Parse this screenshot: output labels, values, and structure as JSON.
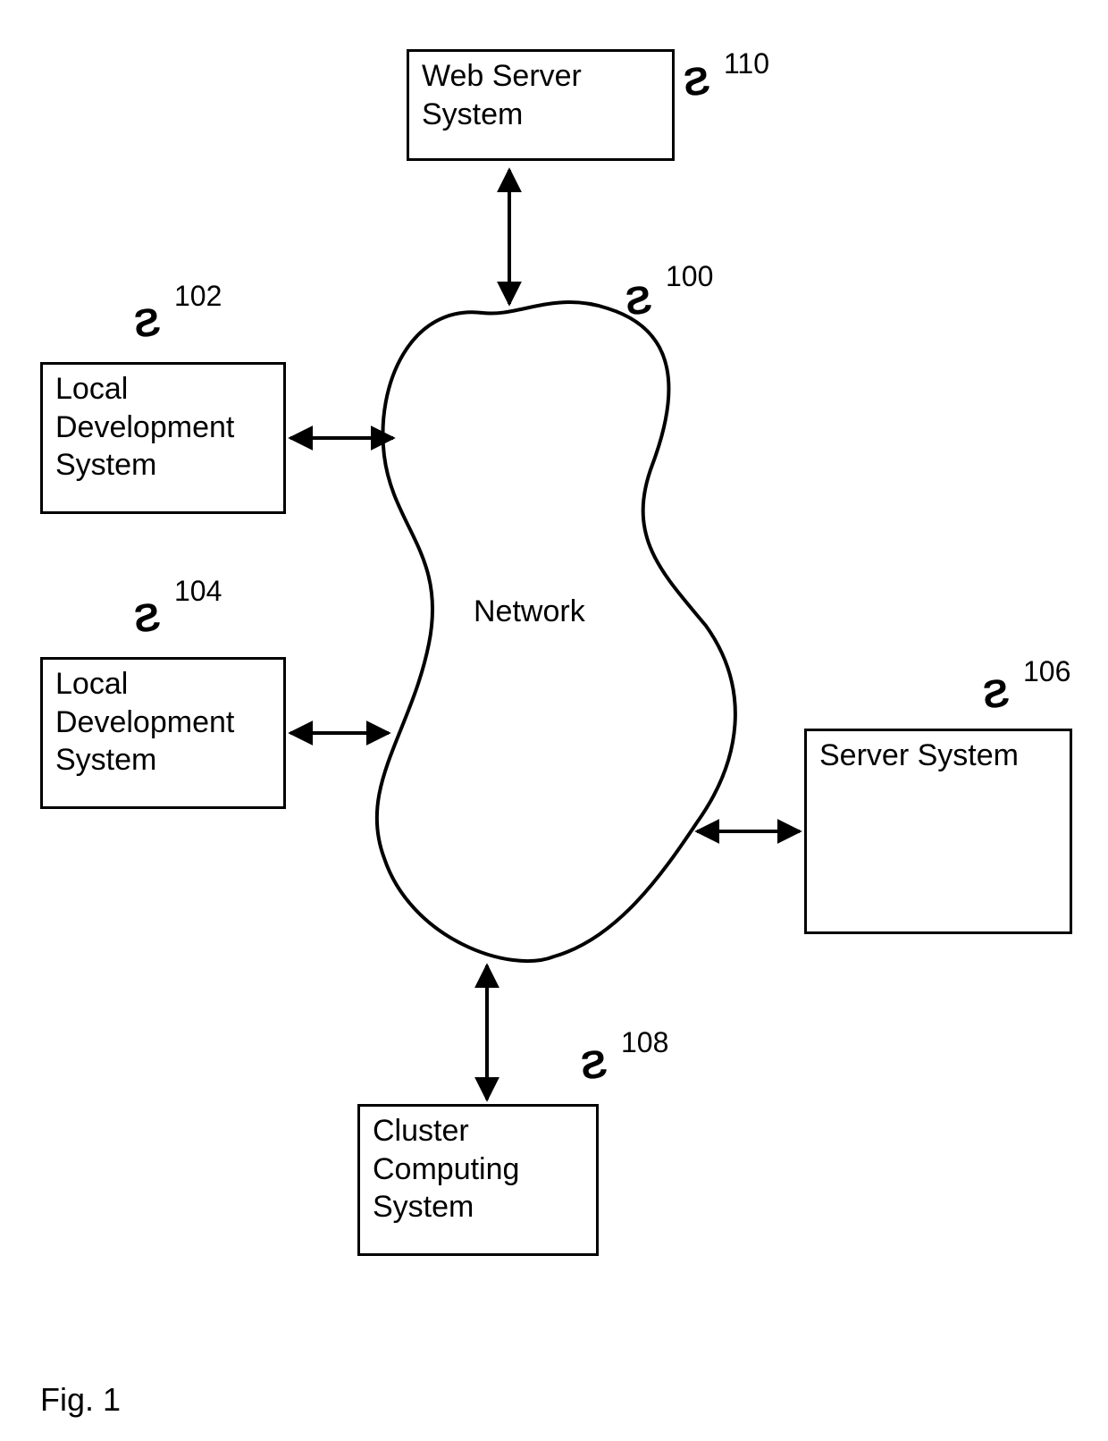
{
  "figure_caption": "Fig. 1",
  "network_label": "Network",
  "nodes": {
    "web_server": {
      "label": "Web Server\nSystem",
      "ref": "110"
    },
    "local_dev_1": {
      "label": "Local\nDevelopment\nSystem",
      "ref": "102"
    },
    "local_dev_2": {
      "label": "Local\nDevelopment\nSystem",
      "ref": "104"
    },
    "server": {
      "label": "Server System",
      "ref": "106"
    },
    "cluster": {
      "label": "Cluster\nComputing\nSystem",
      "ref": "108"
    },
    "network": {
      "ref": "100"
    }
  }
}
